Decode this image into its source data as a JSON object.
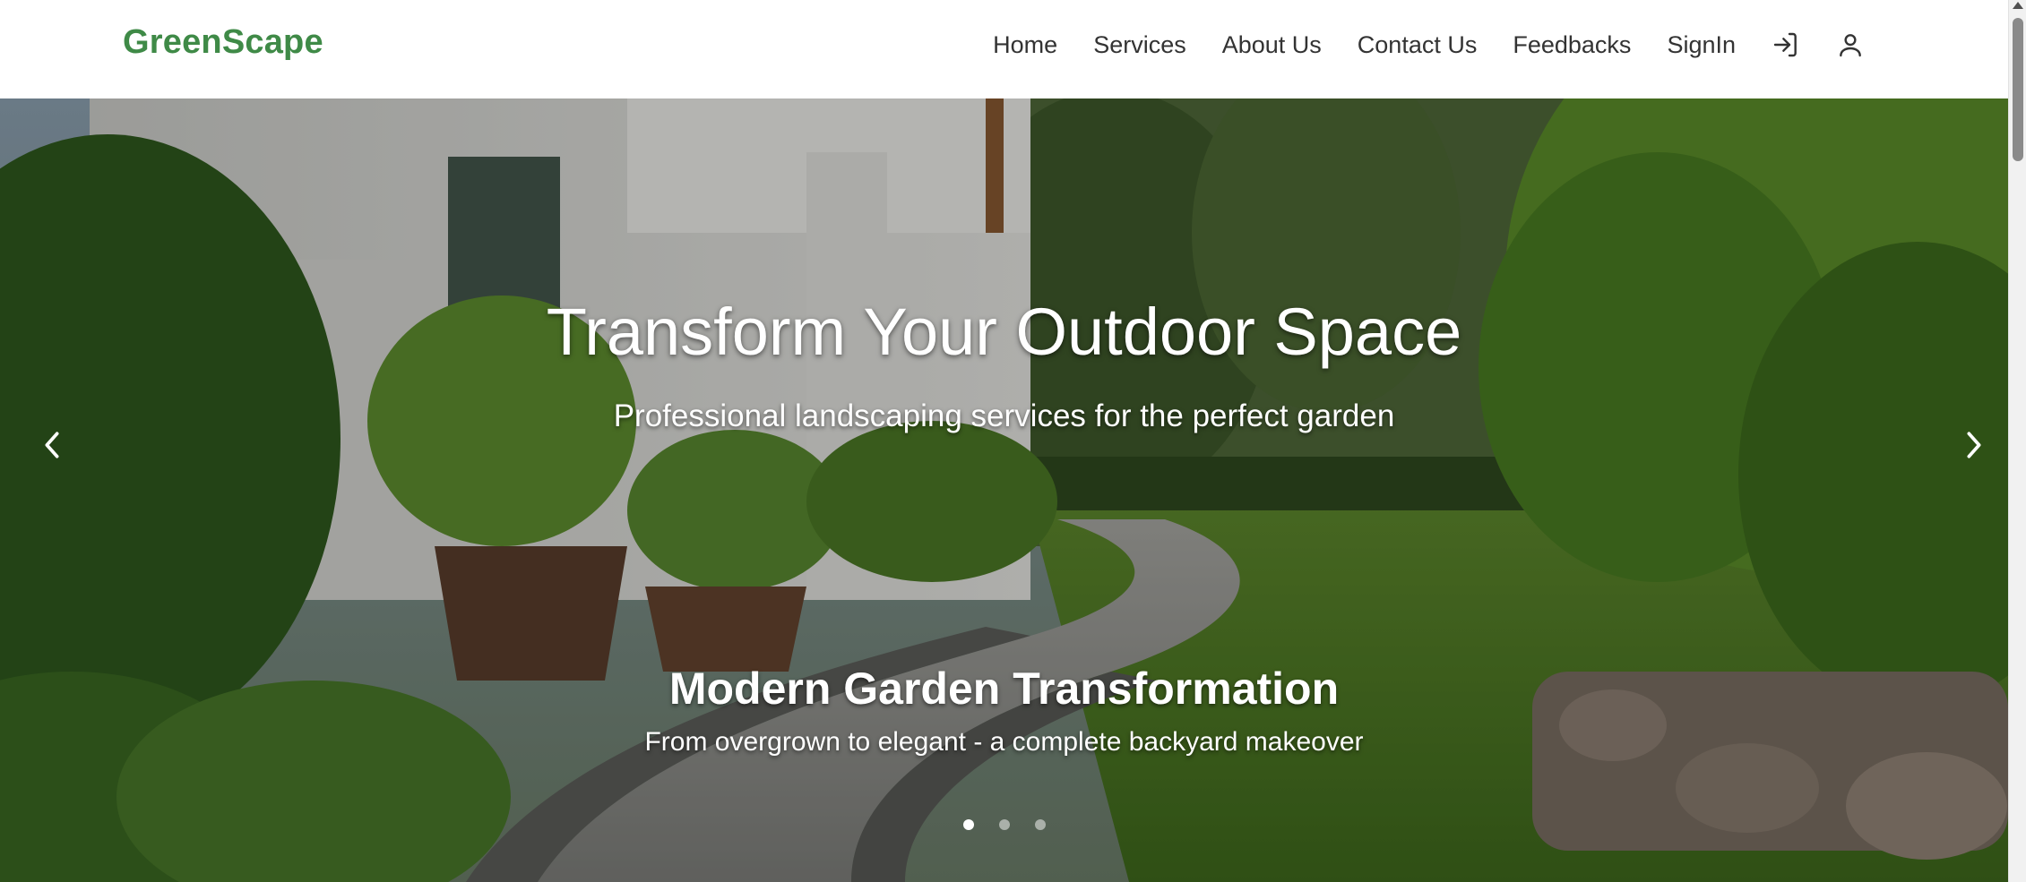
{
  "brand": {
    "name": "GreenScape",
    "color": "#3f8a47"
  },
  "nav": {
    "links": [
      "Home",
      "Services",
      "About Us",
      "Contact Us",
      "Feedbacks",
      "SignIn"
    ],
    "icons": [
      "login-icon",
      "user-icon"
    ]
  },
  "hero": {
    "title": "Transform Your Outdoor Space",
    "subtitle": "Professional landscaping services for the perfect garden"
  },
  "carousel": {
    "caption_title": "Modern Garden Transformation",
    "caption_text": "From overgrown to elegant - a complete backyard makeover",
    "slide_count": 3,
    "active_slide": 1
  },
  "colors": {
    "text_dark": "#333333",
    "hero_text": "#ffffff"
  }
}
